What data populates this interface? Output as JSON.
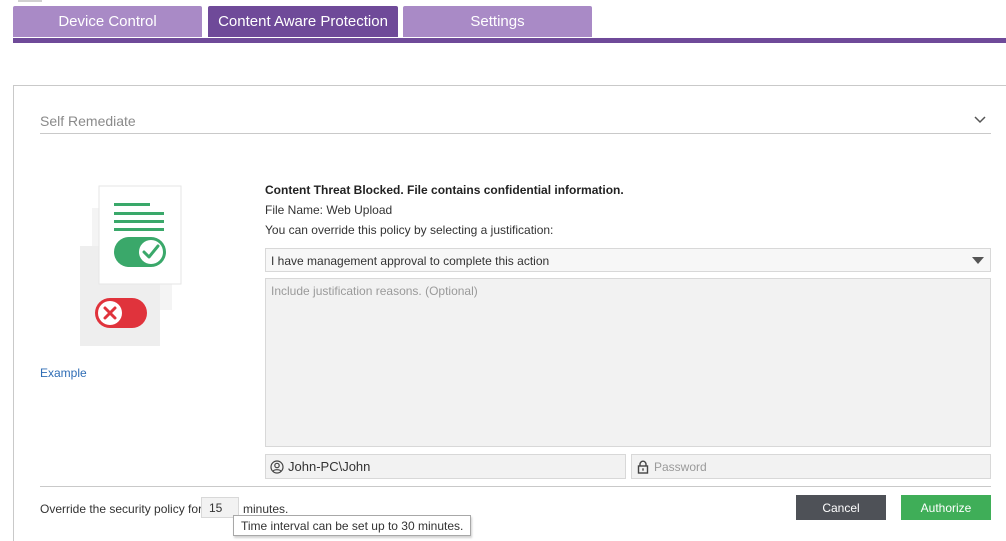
{
  "tabs": [
    {
      "label": "Device Control",
      "active": false
    },
    {
      "label": "Content Aware Protection",
      "active": true
    },
    {
      "label": "Settings",
      "active": false
    }
  ],
  "colors": {
    "tab_active": "#6f4a99",
    "tab_inactive": "#a98ac6",
    "cancel_button": "#4e5157",
    "authorize_button": "#3fae58",
    "link": "#2f6db5"
  },
  "section": {
    "title": "Self Remediate",
    "chevron_icon": "chevron-down-icon"
  },
  "illustration": {
    "icons": [
      "document-icon",
      "toggle-on-check-icon",
      "toggle-off-x-icon"
    ]
  },
  "example_link": "Example",
  "message": {
    "title": "Content Threat Blocked. File contains confidential information.",
    "file_name": "File Name: Web Upload",
    "hint": "You can override this policy by selecting a justification:"
  },
  "justification": {
    "selected": "I have management approval to complete this action",
    "reasons_placeholder": "Include justification reasons. (Optional)"
  },
  "credentials": {
    "username": "John-PC\\John",
    "user_icon": "user-circle-icon",
    "password_placeholder": "Password",
    "password_icon": "lock-icon"
  },
  "override": {
    "label": "Override the security policy for",
    "minutes_value": "15",
    "minutes_label": "minutes.",
    "tooltip": "Time interval can be set up to 30 minutes."
  },
  "buttons": {
    "cancel": "Cancel",
    "authorize": "Authorize"
  }
}
